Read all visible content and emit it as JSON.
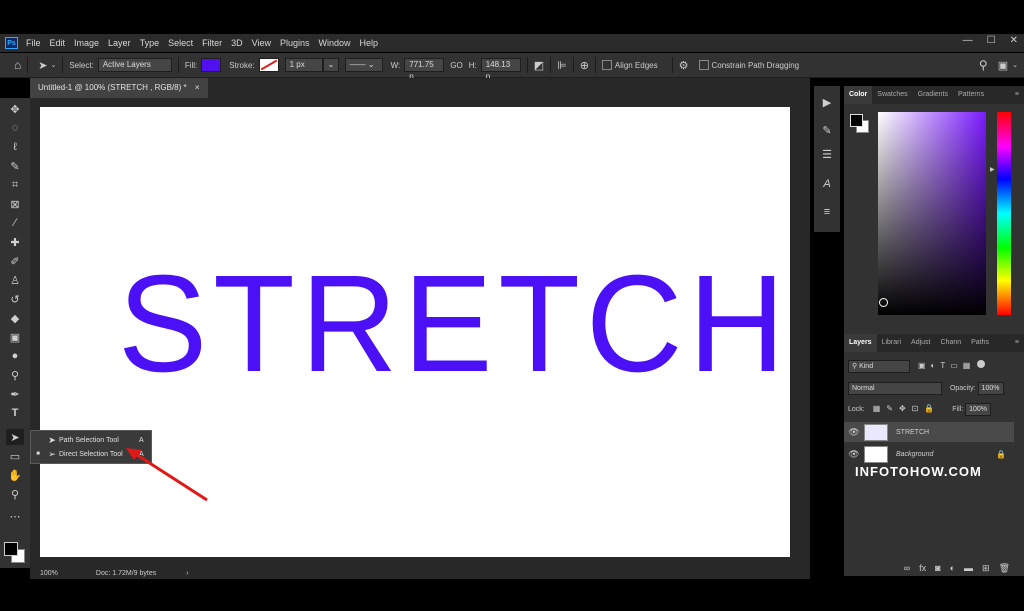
{
  "app": {
    "logo": "Ps"
  },
  "menu": [
    "File",
    "Edit",
    "Image",
    "Layer",
    "Type",
    "Select",
    "Filter",
    "3D",
    "View",
    "Plugins",
    "Window",
    "Help"
  ],
  "window_controls": [
    "—",
    "☐",
    "✕"
  ],
  "options": {
    "select_label": "Select:",
    "select_value": "Active Layers",
    "fill_label": "Fill:",
    "fill_color": "#5010f0",
    "stroke_label": "Stroke:",
    "stroke_width": "1 px",
    "w_label": "W:",
    "w_value": "771.75 p",
    "h_label": "H:",
    "h_value": "148.13 p",
    "align_edges": "Align Edges",
    "constrain": "Constrain Path Dragging"
  },
  "document": {
    "tab_title": "Untitled-1 @ 100% (STRETCH , RGB/8) *",
    "canvas_text": "STRETCH",
    "text_color": "#4b10f5",
    "zoom": "100%",
    "doc_info": "Doc: 1.72M/9 bytes"
  },
  "flyout": {
    "items": [
      {
        "label": "Path Selection Tool",
        "key": "A"
      },
      {
        "label": "Direct Selection Tool",
        "key": "A"
      }
    ]
  },
  "color_panel": {
    "tabs": [
      "Color",
      "Swatches",
      "Gradients",
      "Patterns"
    ]
  },
  "layers_panel": {
    "tabs": [
      "Layers",
      "Librari",
      "Adjust",
      "Chann",
      "Paths"
    ],
    "kind": "Kind",
    "blend": "Normal",
    "opacity_label": "Opacity:",
    "opacity": "100%",
    "lock_label": "Lock:",
    "fill_label": "Fill:",
    "fill": "100%",
    "layers": [
      {
        "name": "STRETCH"
      },
      {
        "name": "Background"
      }
    ]
  },
  "watermark": "INFOTOHOW.COM"
}
